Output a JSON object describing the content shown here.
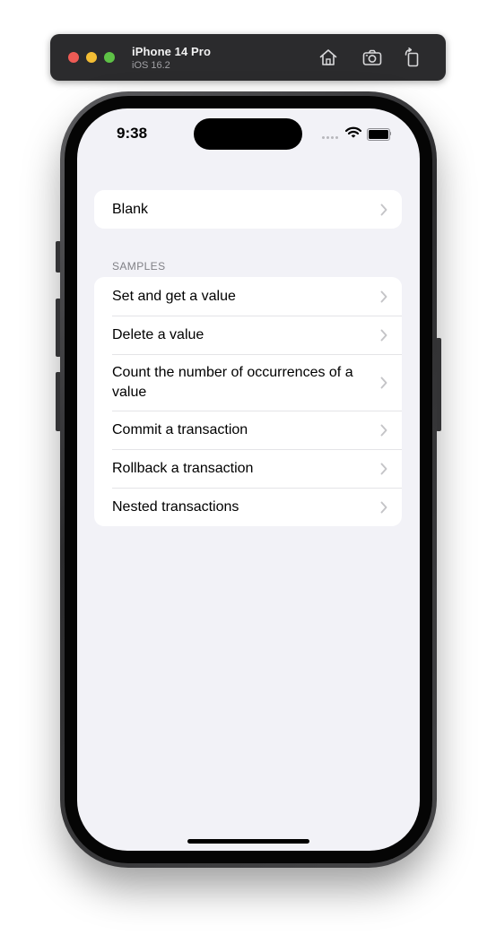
{
  "simulator": {
    "device_name": "iPhone 14 Pro",
    "os_version": "iOS 16.2",
    "buttons": [
      {
        "icon": "home-icon"
      },
      {
        "icon": "screenshot-icon"
      },
      {
        "icon": "rotate-icon"
      }
    ]
  },
  "status_bar": {
    "time": "9:38",
    "signal_icon": "cellular-signal-icon",
    "wifi_icon": "wifi-icon",
    "battery_icon": "battery-icon",
    "battery_level": 1.0
  },
  "blank_section": {
    "items": [
      {
        "label": "Blank",
        "icon": "chevron-right-icon"
      }
    ]
  },
  "samples_section": {
    "header": "SAMPLES",
    "items": [
      {
        "label": "Set and get a value",
        "icon": "chevron-right-icon"
      },
      {
        "label": "Delete a value",
        "icon": "chevron-right-icon"
      },
      {
        "label": "Count the number of occurrences of a value",
        "icon": "chevron-right-icon"
      },
      {
        "label": "Commit a transaction",
        "icon": "chevron-right-icon"
      },
      {
        "label": "Rollback a transaction",
        "icon": "chevron-right-icon"
      },
      {
        "label": "Nested transactions",
        "icon": "chevron-right-icon"
      }
    ]
  },
  "colors": {
    "background": "#f2f2f7",
    "cell": "#ffffff",
    "section_header": "#808086",
    "chevron": "#c4c4c7",
    "separator": "#e4e4e7"
  }
}
